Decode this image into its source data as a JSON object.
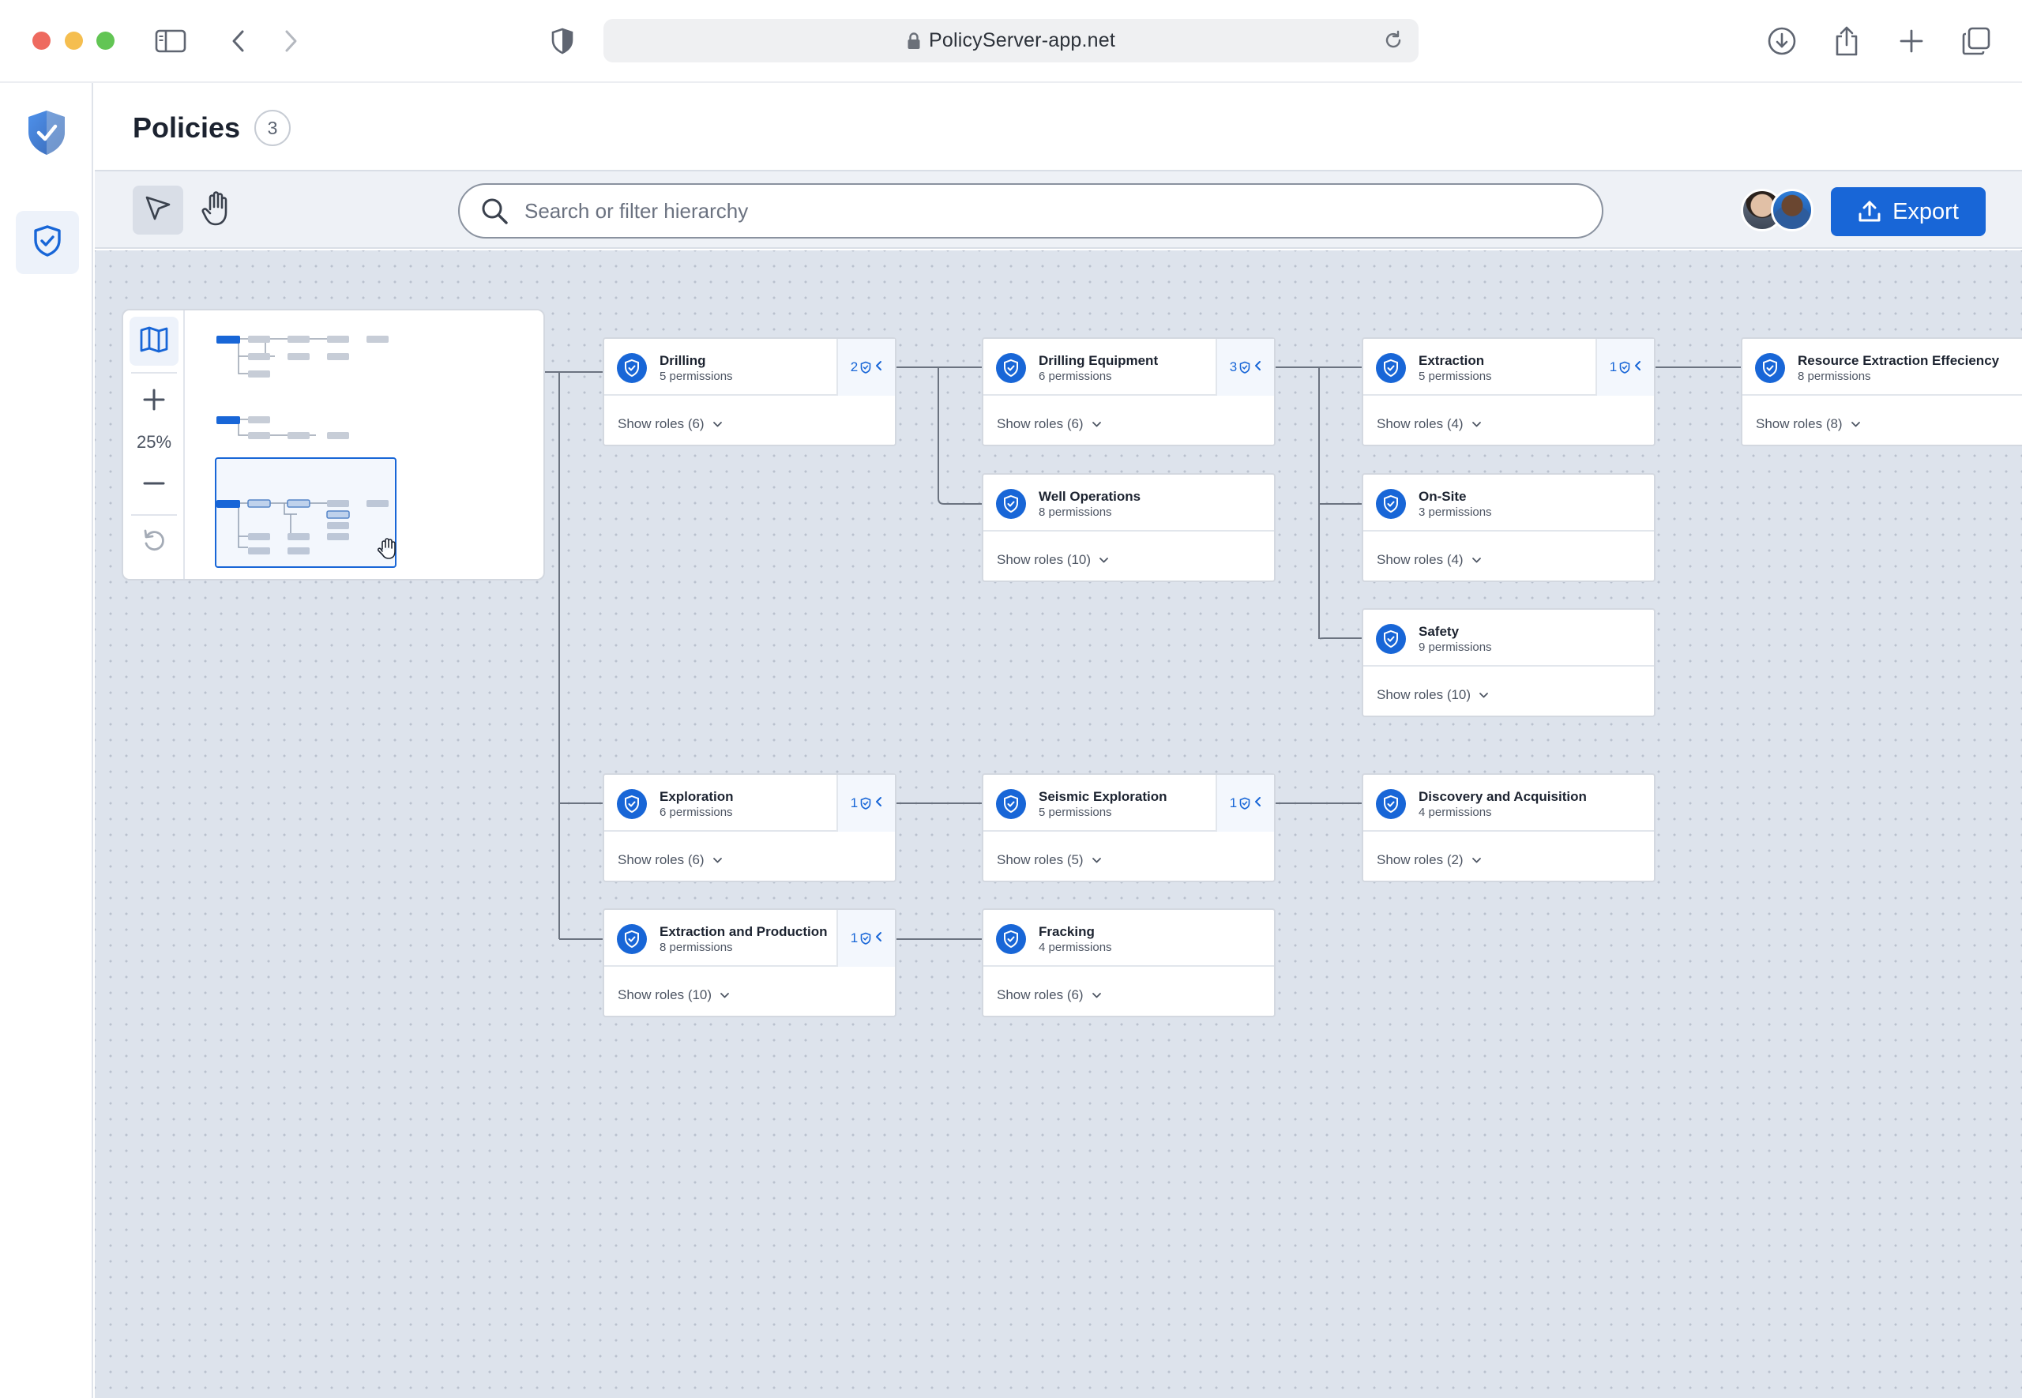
{
  "browser": {
    "url": "PolicyServer-app.net"
  },
  "header": {
    "title": "Policies",
    "count": "3"
  },
  "toolbar": {
    "search_placeholder": "Search or filter hierarchy",
    "export_label": "Export"
  },
  "minimap": {
    "zoom": "25%"
  },
  "cards": [
    {
      "title": "Drilling",
      "subtitle": "5 permissions",
      "badge": "2",
      "roles": "Show roles (6)"
    },
    {
      "title": "Drilling Equipment",
      "subtitle": "6 permissions",
      "badge": "3",
      "roles": "Show roles (6)"
    },
    {
      "title": "Extraction",
      "subtitle": "5 permissions",
      "badge": "1",
      "roles": "Show roles (4)"
    },
    {
      "title": "Resource Extraction Effeciency",
      "subtitle": "8 permissions",
      "roles": "Show roles (8)"
    },
    {
      "title": "Well Operations",
      "subtitle": "8 permissions",
      "roles": "Show roles (10)"
    },
    {
      "title": "On-Site",
      "subtitle": "3 permissions",
      "roles": "Show roles (4)"
    },
    {
      "title": "Safety",
      "subtitle": "9 permissions",
      "roles": "Show roles (10)"
    },
    {
      "title": "Exploration",
      "subtitle": "6 permissions",
      "badge": "1",
      "roles": "Show roles (6)"
    },
    {
      "title": "Seismic Exploration",
      "subtitle": "5 permissions",
      "badge": "1",
      "roles": "Show roles (5)"
    },
    {
      "title": "Discovery and Acquisition",
      "subtitle": "4 permissions",
      "roles": "Show roles (2)"
    },
    {
      "title": "Extraction and Production",
      "subtitle": "8 permissions",
      "badge": "1",
      "roles": "Show roles (10)"
    },
    {
      "title": "Fracking",
      "subtitle": "4 permissions",
      "roles": "Show roles (6)"
    }
  ],
  "colors": {
    "accent": "#1866d7",
    "canvas": "#dde3ec",
    "connector": "#6b7380"
  }
}
